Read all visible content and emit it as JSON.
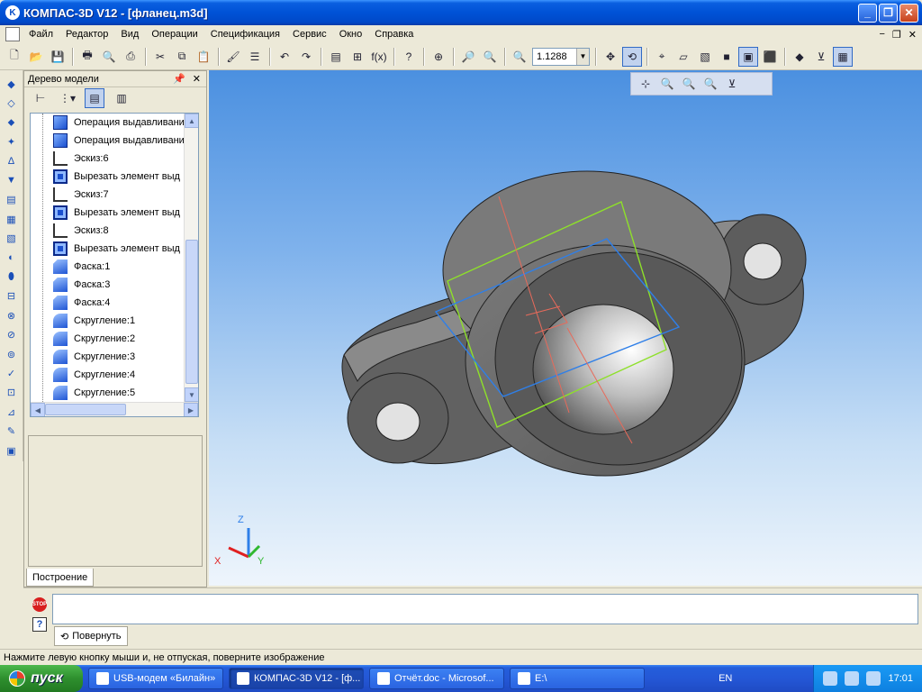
{
  "window": {
    "title": "КОМПАС-3D V12 - [фланец.m3d]",
    "minimize_glyph": "_",
    "maximize_glyph": "❐",
    "close_glyph": "✕"
  },
  "menu": {
    "items": [
      "Файл",
      "Редактор",
      "Вид",
      "Операции",
      "Спецификация",
      "Сервис",
      "Окно",
      "Справка"
    ],
    "doc_minimize_glyph": "−",
    "doc_restore_glyph": "❐",
    "doc_close_glyph": "✕"
  },
  "toolbar": {
    "zoom_value": "1.1288",
    "zoom_dropdown_glyph": "▼",
    "icons": {
      "new": "🗋",
      "open": "📂",
      "save": "💾",
      "print": "🖶",
      "preview": "🔍",
      "print_setup": "⎙",
      "cut": "✂",
      "copy": "⧉",
      "paste": "📋",
      "format": "🖌",
      "props": "☰",
      "undo": "↶",
      "redo": "↷",
      "manager": "▤",
      "library": "⊞",
      "fx": "f(x)",
      "help": "?",
      "zoom_fit": "⊕",
      "zoom_in": "🔎",
      "zoom_out": "🔍",
      "zoom_scale": "🔍",
      "pan": "✥",
      "rotate": "⟲",
      "orient": "⌖",
      "wire": "▱",
      "hidden": "▧",
      "shade": "■",
      "shade_edges": "▣",
      "perspective": "⬛",
      "view": "◆",
      "filter": "⊻",
      "sketch_mode": "▦"
    }
  },
  "subtoolbar": {
    "icons": {
      "axes": "⊹",
      "zoom1": "🔍",
      "zoom2": "🔍",
      "zoom3": "🔍",
      "filter": "⊻"
    }
  },
  "tree": {
    "title": "Дерево модели",
    "pin_glyph": "📌",
    "close_glyph": "✕",
    "tab": "Построение",
    "items": [
      {
        "label": "Операция выдавливани",
        "icon": "extrude"
      },
      {
        "label": "Операция выдавливани",
        "icon": "extrude"
      },
      {
        "label": "Эскиз:6",
        "icon": "sketch"
      },
      {
        "label": "Вырезать элемент выд",
        "icon": "cut"
      },
      {
        "label": "Эскиз:7",
        "icon": "sketch"
      },
      {
        "label": "Вырезать элемент выд",
        "icon": "cut"
      },
      {
        "label": "Эскиз:8",
        "icon": "sketch"
      },
      {
        "label": "Вырезать элемент выд",
        "icon": "cut"
      },
      {
        "label": "Фаска:1",
        "icon": "chamfer"
      },
      {
        "label": "Фаска:3",
        "icon": "chamfer"
      },
      {
        "label": "Фаска:4",
        "icon": "chamfer"
      },
      {
        "label": "Скругление:1",
        "icon": "fillet"
      },
      {
        "label": "Скругление:2",
        "icon": "fillet"
      },
      {
        "label": "Скругление:3",
        "icon": "fillet"
      },
      {
        "label": "Скругление:4",
        "icon": "fillet"
      },
      {
        "label": "Скругление:5",
        "icon": "fillet"
      }
    ]
  },
  "axes": {
    "x": "X",
    "y": "Y",
    "z": "Z"
  },
  "bottom": {
    "stop_label": "STOP",
    "help_glyph": "?",
    "command_tab": "Повернуть",
    "command_icon": "⟲"
  },
  "status": {
    "hint": "Нажмите левую кнопку мыши и, не отпуская, поверните изображение"
  },
  "taskbar": {
    "start": "пуск",
    "tasks": [
      {
        "label": "USB-модем «Билайн»",
        "active": false
      },
      {
        "label": "КОМПАС-3D V12 - [ф...",
        "active": true
      },
      {
        "label": "Отчёт.doc - Microsof...",
        "active": false
      },
      {
        "label": "E:\\",
        "active": false
      }
    ],
    "language": "EN",
    "clock": "17:01"
  },
  "colors": {
    "viewport_top": "#4b90e0",
    "viewport_bottom": "#eef5fc",
    "part": "#6b6b6b",
    "plane_green": "#8ee02a",
    "plane_blue": "#2f7fe8",
    "sketch_red": "#e86a5a"
  }
}
